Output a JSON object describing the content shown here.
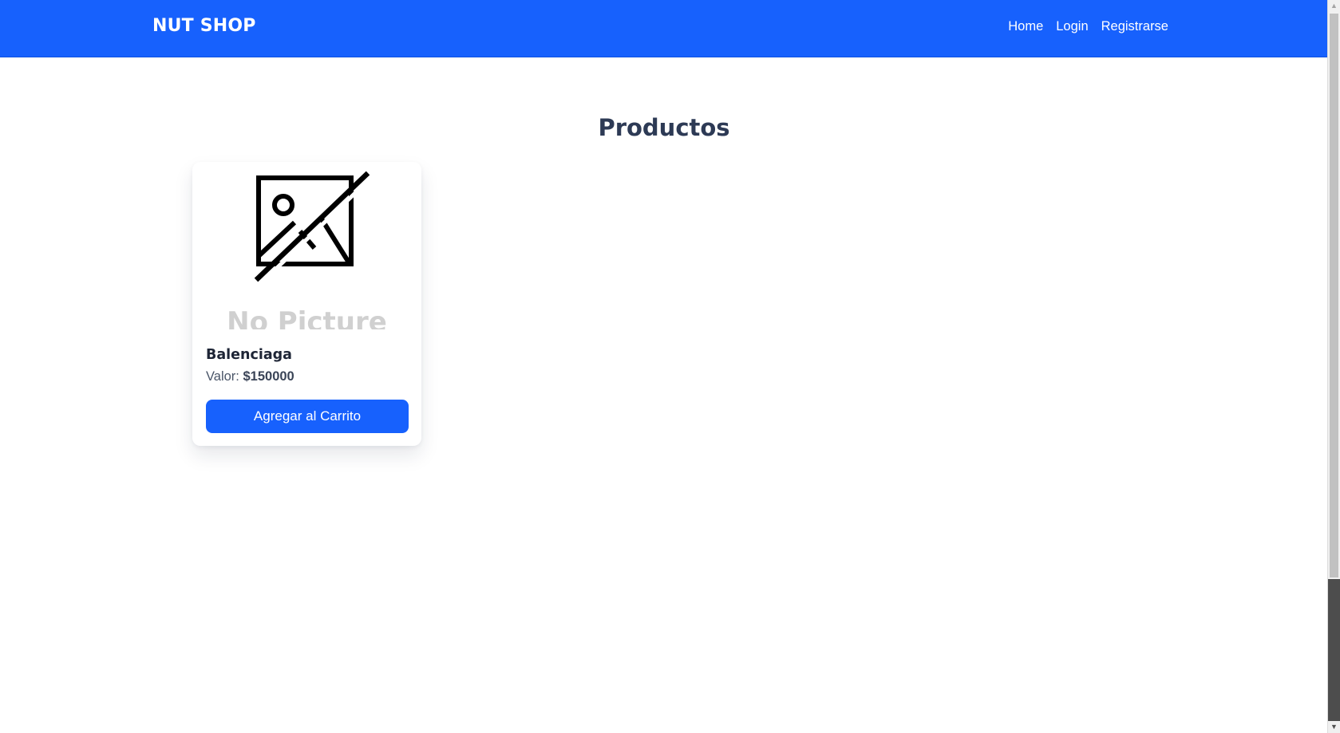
{
  "navbar": {
    "brand": "NUT SHOP",
    "links": [
      {
        "label": "Home"
      },
      {
        "label": "Login"
      },
      {
        "label": "Registrarse"
      }
    ]
  },
  "main": {
    "title": "Productos",
    "products": [
      {
        "image_placeholder_text": "No Picture",
        "name": "Balenciaga",
        "price_label": "Valor:",
        "price_value": "$150000",
        "button_label": "Agregar al Carrito"
      }
    ]
  },
  "icons": {
    "product_image": "no-picture-icon",
    "scroll_up": "scroll-up-arrow-icon",
    "scroll_down": "scroll-down-arrow-icon"
  },
  "colors": {
    "primary": "#1761fd",
    "title_text": "#2d3a55",
    "placeholder_text": "#d0d0d0"
  }
}
